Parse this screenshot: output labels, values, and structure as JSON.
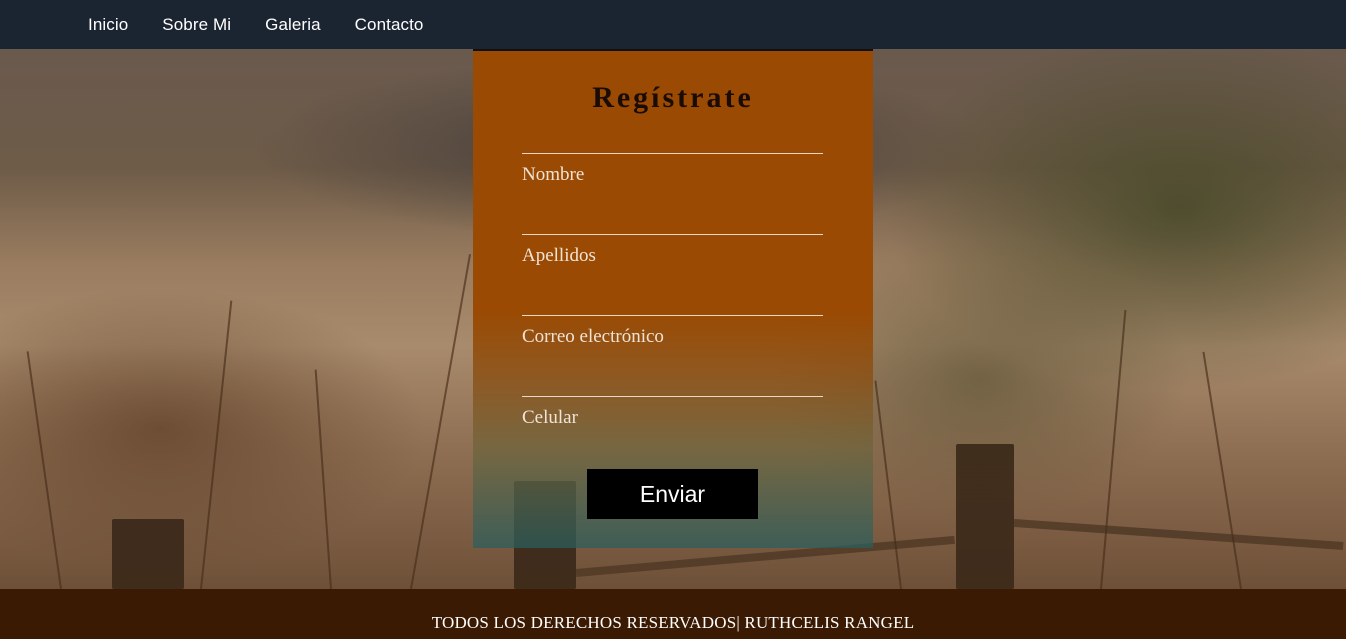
{
  "nav": {
    "items": [
      {
        "label": "Inicio"
      },
      {
        "label": "Sobre Mi"
      },
      {
        "label": "Galeria"
      },
      {
        "label": "Contacto"
      }
    ]
  },
  "form": {
    "title": "Regístrate",
    "fields": [
      {
        "label": "Nombre"
      },
      {
        "label": "Apellidos"
      },
      {
        "label": "Correo electrónico"
      },
      {
        "label": "Celular"
      }
    ],
    "submit_label": "Enviar"
  },
  "footer": {
    "text": "TODOS LOS DERECHOS RESERVADOS| RUTHCELIS RANGEL"
  },
  "colors": {
    "navbar": "#1b2431",
    "card": "#9a4a02",
    "button": "#000000",
    "footer": "#3a1a02"
  },
  "background": {
    "icon": "countryside-fence-photo"
  }
}
